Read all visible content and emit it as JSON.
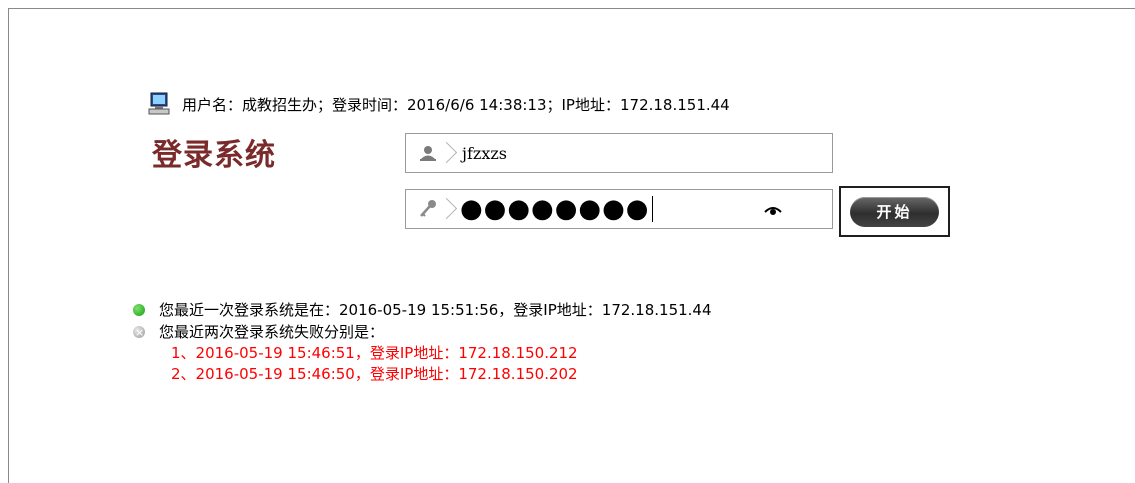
{
  "session": {
    "text": "用户名：成教招生办；登录时间：2016/6/6 14:38:13；IP地址：172.18.151.44"
  },
  "title": "登录系统",
  "form": {
    "username_value": "jfzxzs",
    "password_masked": "●●●●●●●●",
    "start_label": "开始"
  },
  "history": {
    "last_login": "您最近一次登录系统是在：2016-05-19 15:51:56，登录IP地址：172.18.151.44",
    "fail_heading": "您最近两次登录系统失败分别是：",
    "failures": [
      "1、2016-05-19 15:46:51，登录IP地址：172.18.150.212",
      "2、2016-05-19 15:46:50，登录IP地址：172.18.150.202"
    ]
  },
  "colors": {
    "title": "#7a2a2a",
    "failure_text": "#ff0000",
    "success_bullet": "#1c9c16"
  },
  "icons": [
    "computer-icon",
    "user-icon",
    "key-icon",
    "eye-icon"
  ]
}
